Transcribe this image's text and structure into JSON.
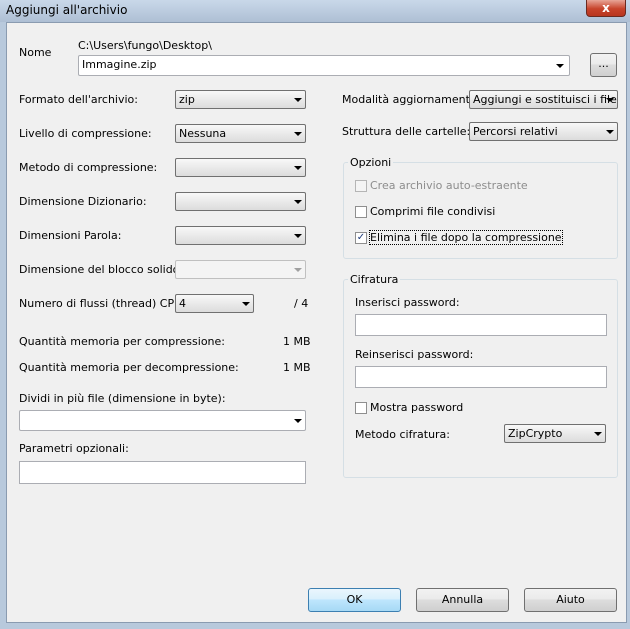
{
  "window": {
    "title": "Aggiungi all'archivio",
    "close_glyph": "x"
  },
  "name": {
    "label": "Nome",
    "path": "C:\\Users\\fungo\\Desktop\\",
    "filename": "Immagine.zip",
    "browse_label": "..."
  },
  "left": {
    "format_label": "Formato dell'archivio:",
    "format_value": "zip",
    "level_label": "Livello di compressione:",
    "level_value": "Nessuna",
    "method_label": "Metodo di compressione:",
    "method_value": "",
    "dict_label": "Dimensione Dizionario:",
    "dict_value": "",
    "word_label": "Dimensioni Parola:",
    "word_value": "",
    "block_label": "Dimensione del blocco solido:",
    "block_value": "",
    "threads_label": "Numero di flussi (thread) CPU:",
    "threads_value": "4",
    "threads_total": "/ 4",
    "mem_comp_label": "Quantità memoria per compressione:",
    "mem_comp_value": "1 MB",
    "mem_decomp_label": "Quantità memoria per decompressione:",
    "mem_decomp_value": "1 MB",
    "split_label": "Dividi in più file (dimensione in byte):",
    "split_value": "",
    "params_label": "Parametri opzionali:",
    "params_value": ""
  },
  "right": {
    "update_label": "Modalità aggiornamento:",
    "update_value": "Aggiungi e sostituisci i file",
    "paths_label": "Struttura delle cartelle:",
    "paths_value": "Percorsi relativi",
    "options": {
      "title": "Opzioni",
      "sfx_label": "Crea archivio auto-estraente",
      "sfx_checked": false,
      "shared_label": "Comprimi file condivisi",
      "shared_checked": false,
      "delete_label": "Elimina i file dopo la compressione",
      "delete_checked": true,
      "check_glyph": "✓"
    },
    "encryption": {
      "title": "Cifratura",
      "password_label": "Inserisci password:",
      "password_value": "",
      "repeat_label": "Reinserisci password:",
      "repeat_value": "",
      "show_label": "Mostra password",
      "show_checked": false,
      "method_label": "Metodo cifratura:",
      "method_value": "ZipCrypto"
    }
  },
  "buttons": {
    "ok": "OK",
    "cancel": "Annulla",
    "help": "Aiuto"
  }
}
